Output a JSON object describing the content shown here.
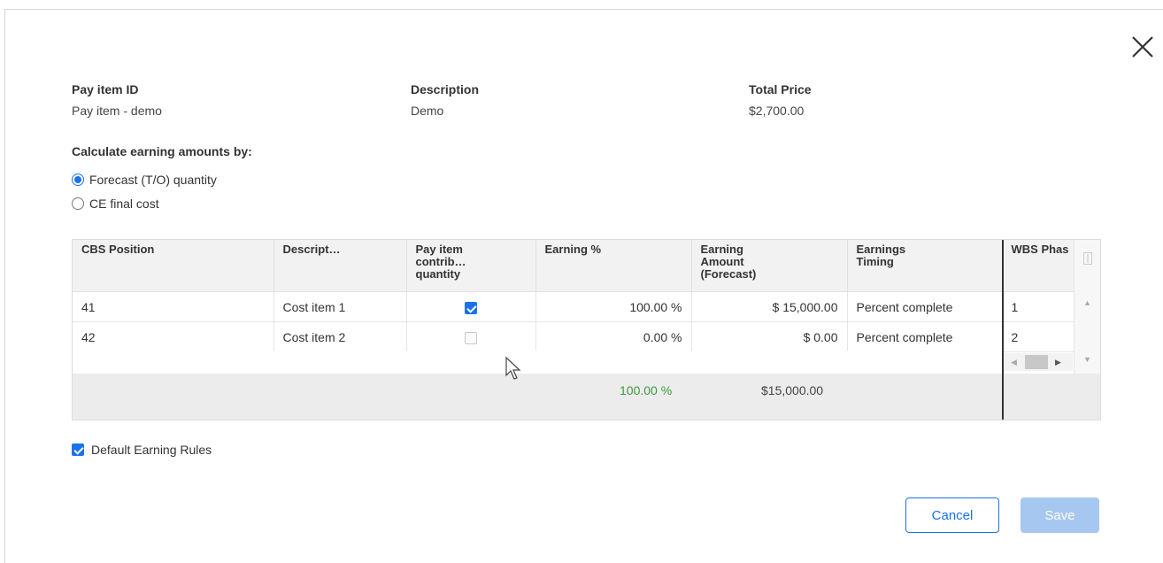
{
  "header": {
    "pay_item_id": {
      "label": "Pay item ID",
      "value": "Pay item - demo"
    },
    "description": {
      "label": "Description",
      "value": "Demo"
    },
    "total_price": {
      "label": "Total Price",
      "value": "$2,700.00"
    }
  },
  "calculation": {
    "label": "Calculate earning amounts by:",
    "options": [
      {
        "label": "Forecast (T/O) quantity",
        "selected": true
      },
      {
        "label": "CE final cost",
        "selected": false
      }
    ]
  },
  "grid": {
    "columns": [
      {
        "line1": "CBS Position",
        "line2": "",
        "line3": ""
      },
      {
        "line1": "Descript…",
        "line2": "",
        "line3": ""
      },
      {
        "line1": "Pay item",
        "line2": "contrib…",
        "line3": "quantity"
      },
      {
        "line1": "Earning %",
        "line2": "",
        "line3": ""
      },
      {
        "line1": "Earning",
        "line2": "Amount",
        "line3": "(Forecast)"
      },
      {
        "line1": "Earnings",
        "line2": "Timing",
        "line3": ""
      },
      {
        "line1": "WBS Phas",
        "line2": "",
        "line3": ""
      }
    ],
    "rows": [
      {
        "cbs": "41",
        "description": "Cost item 1",
        "contributes": true,
        "earning_pct": "100.00 %",
        "earning_amount": "$ 15,000.00",
        "timing": "Percent complete",
        "wbs": "1"
      },
      {
        "cbs": "42",
        "description": "Cost item 2",
        "contributes": false,
        "earning_pct": "0.00 %",
        "earning_amount": "$ 0.00",
        "timing": "Percent complete",
        "wbs": "2"
      }
    ],
    "totals": {
      "earning_pct": "100.00 %",
      "earning_amount": "$15,000.00"
    }
  },
  "default_rules": {
    "label": "Default Earning Rules",
    "checked": true
  },
  "buttons": {
    "cancel": "Cancel",
    "save": "Save"
  },
  "colors": {
    "accent": "#1a73e8",
    "save_disabled": "#a6c8f0",
    "total_pct": "#3c9a3c"
  }
}
